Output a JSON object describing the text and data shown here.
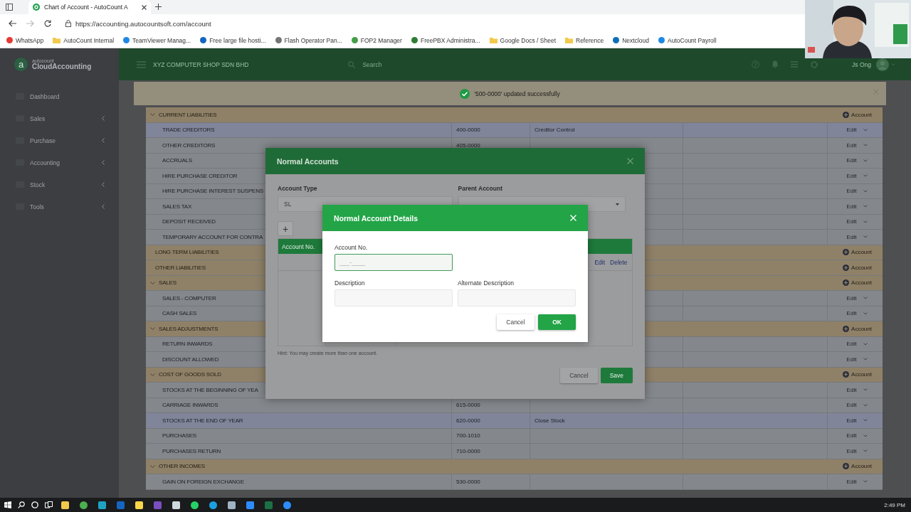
{
  "browser": {
    "tab_title": "Chart of Account - AutoCount A",
    "url": "https://accounting.autocountsoft.com/account",
    "bookmarks": [
      {
        "label": "WhatsApp",
        "kind": "site",
        "color": "#e53935"
      },
      {
        "label": "AutoCount Internal",
        "kind": "folder"
      },
      {
        "label": "TeamViewer Manag...",
        "kind": "site",
        "color": "#1e88e5"
      },
      {
        "label": "Free large file hosti...",
        "kind": "site",
        "color": "#1565c0"
      },
      {
        "label": "Flash Operator Pan...",
        "kind": "site",
        "color": "#757575"
      },
      {
        "label": "FOP2 Manager",
        "kind": "site",
        "color": "#43a047"
      },
      {
        "label": "FreePBX Administra...",
        "kind": "site",
        "color": "#2e7d32"
      },
      {
        "label": "Google Docs / Sheet",
        "kind": "folder"
      },
      {
        "label": "Reference",
        "kind": "folder"
      },
      {
        "label": "Nextcloud",
        "kind": "site",
        "color": "#0d6fb8"
      },
      {
        "label": "AutoCount Payroll",
        "kind": "site",
        "color": "#1e88e5"
      }
    ]
  },
  "sidebar": {
    "logo_mark": "a",
    "brand_small": "autocount",
    "brand": "CloudAccounting",
    "items": [
      {
        "label": "Dashboard",
        "submenu": false
      },
      {
        "label": "Sales",
        "submenu": true
      },
      {
        "label": "Purchase",
        "submenu": true
      },
      {
        "label": "Accounting",
        "submenu": true
      },
      {
        "label": "Stock",
        "submenu": true
      },
      {
        "label": "Tools",
        "submenu": true
      }
    ]
  },
  "header": {
    "company": "XYZ COMPUTER SHOP SDN BHD",
    "search_placeholder": "Search",
    "user": "Js Ong"
  },
  "notification": {
    "message": "'500-0000' updated successfully"
  },
  "rows": [
    {
      "kind": "group",
      "name": "CURRENT LIABILITIES",
      "expanded": true,
      "action": "Account"
    },
    {
      "kind": "account",
      "name": "TRADE CREDITORS",
      "account_no": "400-0000",
      "description": "Creditor Control",
      "action": "Edit"
    },
    {
      "kind": "account",
      "name": "OTHER CREDITORS",
      "account_no": "405-0000",
      "action": "Edit"
    },
    {
      "kind": "account",
      "name": "ACCRUALS",
      "action": "Edit"
    },
    {
      "kind": "account",
      "name": "HIRE PURCHASE CREDITOR",
      "action": "Edit"
    },
    {
      "kind": "account",
      "name": "HIRE PURCHASE INTEREST SUSPENS",
      "action": "Edit"
    },
    {
      "kind": "account",
      "name": "SALES TAX",
      "action": "Edit"
    },
    {
      "kind": "account",
      "name": "DEPOSIT RECEIVED",
      "action": "Edit"
    },
    {
      "kind": "account",
      "name": "TEMPORARY ACCOUNT FOR CONTRA",
      "action": "Edit"
    },
    {
      "kind": "group",
      "name": "LONG TERM LIABILITIES",
      "expanded": false,
      "action": "Account"
    },
    {
      "kind": "group",
      "name": "OTHER LIABILITIES",
      "expanded": false,
      "action": "Account"
    },
    {
      "kind": "group",
      "name": "SALES",
      "expanded": true,
      "action": "Account"
    },
    {
      "kind": "account",
      "name": "SALES - COMPUTER",
      "action": "Edit"
    },
    {
      "kind": "account",
      "name": "CASH SALES",
      "action": "Edit"
    },
    {
      "kind": "group",
      "name": "SALES ADJUSTMENTS",
      "expanded": true,
      "action": "Account"
    },
    {
      "kind": "account",
      "name": "RETURN INWARDS",
      "action": "Edit"
    },
    {
      "kind": "account",
      "name": "DISCOUNT ALLOWED",
      "action": "Edit"
    },
    {
      "kind": "group",
      "name": "COST OF GOODS SOLD",
      "expanded": true,
      "action": "Account"
    },
    {
      "kind": "account",
      "name": "STOCKS AT THE BEGINNING OF YEA",
      "action": "Edit"
    },
    {
      "kind": "account",
      "name": "CARRIAGE INWARDS",
      "account_no": "615-0000",
      "action": "Edit"
    },
    {
      "kind": "account",
      "name": "STOCKS AT THE END OF YEAR",
      "account_no": "620-0000",
      "description": "Close Stock",
      "action": "Edit"
    },
    {
      "kind": "account",
      "name": "PURCHASES",
      "account_no": "700-1010",
      "action": "Edit"
    },
    {
      "kind": "account",
      "name": "PURCHASES RETURN",
      "account_no": "710-0000",
      "action": "Edit"
    },
    {
      "kind": "group",
      "name": "OTHER INCOMES",
      "expanded": true,
      "action": "Account"
    },
    {
      "kind": "account",
      "name": "GAIN ON FOREIGN EXCHANGE",
      "account_no": "530-0000",
      "action": "Edit"
    }
  ],
  "dialog": {
    "title": "Normal Accounts",
    "account_type_label": "Account Type",
    "account_type_value": "SL",
    "parent_account_label": "Parent Account",
    "add_button": "+",
    "column": "Account No.",
    "row_actions": [
      "Edit",
      "Delete"
    ],
    "hint": "Hint: You may create more than one account.",
    "buttons": [
      {
        "label": "Cancel",
        "kind": "default"
      },
      {
        "label": "Save",
        "kind": "primary"
      }
    ]
  },
  "details": {
    "title": "Normal Account Details",
    "fields": [
      {
        "label": "Account No.",
        "placeholder": "___-____",
        "focused": true
      },
      {
        "label": "Description",
        "focused": false
      },
      {
        "label": "Alternate Description",
        "focused": false
      }
    ],
    "buttons": [
      {
        "label": "Cancel",
        "kind": "default"
      },
      {
        "label": "OK",
        "kind": "primary"
      }
    ]
  },
  "taskbar": {
    "time": "2:49 PM"
  }
}
